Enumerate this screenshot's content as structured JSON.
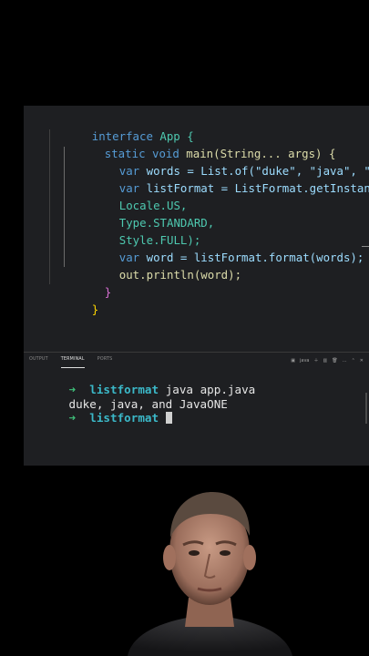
{
  "editor": {
    "lines": [
      [
        "interface",
        " App {"
      ],
      [
        "static void",
        " main(String... args) {"
      ],
      [
        "var",
        " words = List.of(\"duke\", \"java\", \"JavaO"
      ],
      [
        "var",
        " listFormat = ListFormat.getInstance("
      ],
      [
        "",
        "Locale.US,"
      ],
      [
        "",
        "Type.STANDARD,"
      ],
      [
        "",
        "Style.FULL);"
      ],
      [
        "var",
        " word = listFormat.format(words);"
      ],
      [
        "",
        "out.println(word);"
      ],
      [
        "",
        "}"
      ],
      [
        "",
        "}"
      ]
    ]
  },
  "terminal": {
    "tabs": [
      "OUTPUT",
      "TERMINAL",
      "PORTS"
    ],
    "active_tab": "TERMINAL",
    "shell_label": "java",
    "prompt_symbol": "➜",
    "directory": "listformat",
    "command": "java app.java",
    "output": "duke, java, and JavaONE"
  },
  "colors": {
    "background": "#000000",
    "panel": "#1e1f22",
    "keyword": "#569cd6",
    "type": "#4ec9b0",
    "method": "#dcdcaa",
    "string": "#ce9178",
    "prompt": "#3fc07a",
    "directory": "#3bb8c8"
  }
}
